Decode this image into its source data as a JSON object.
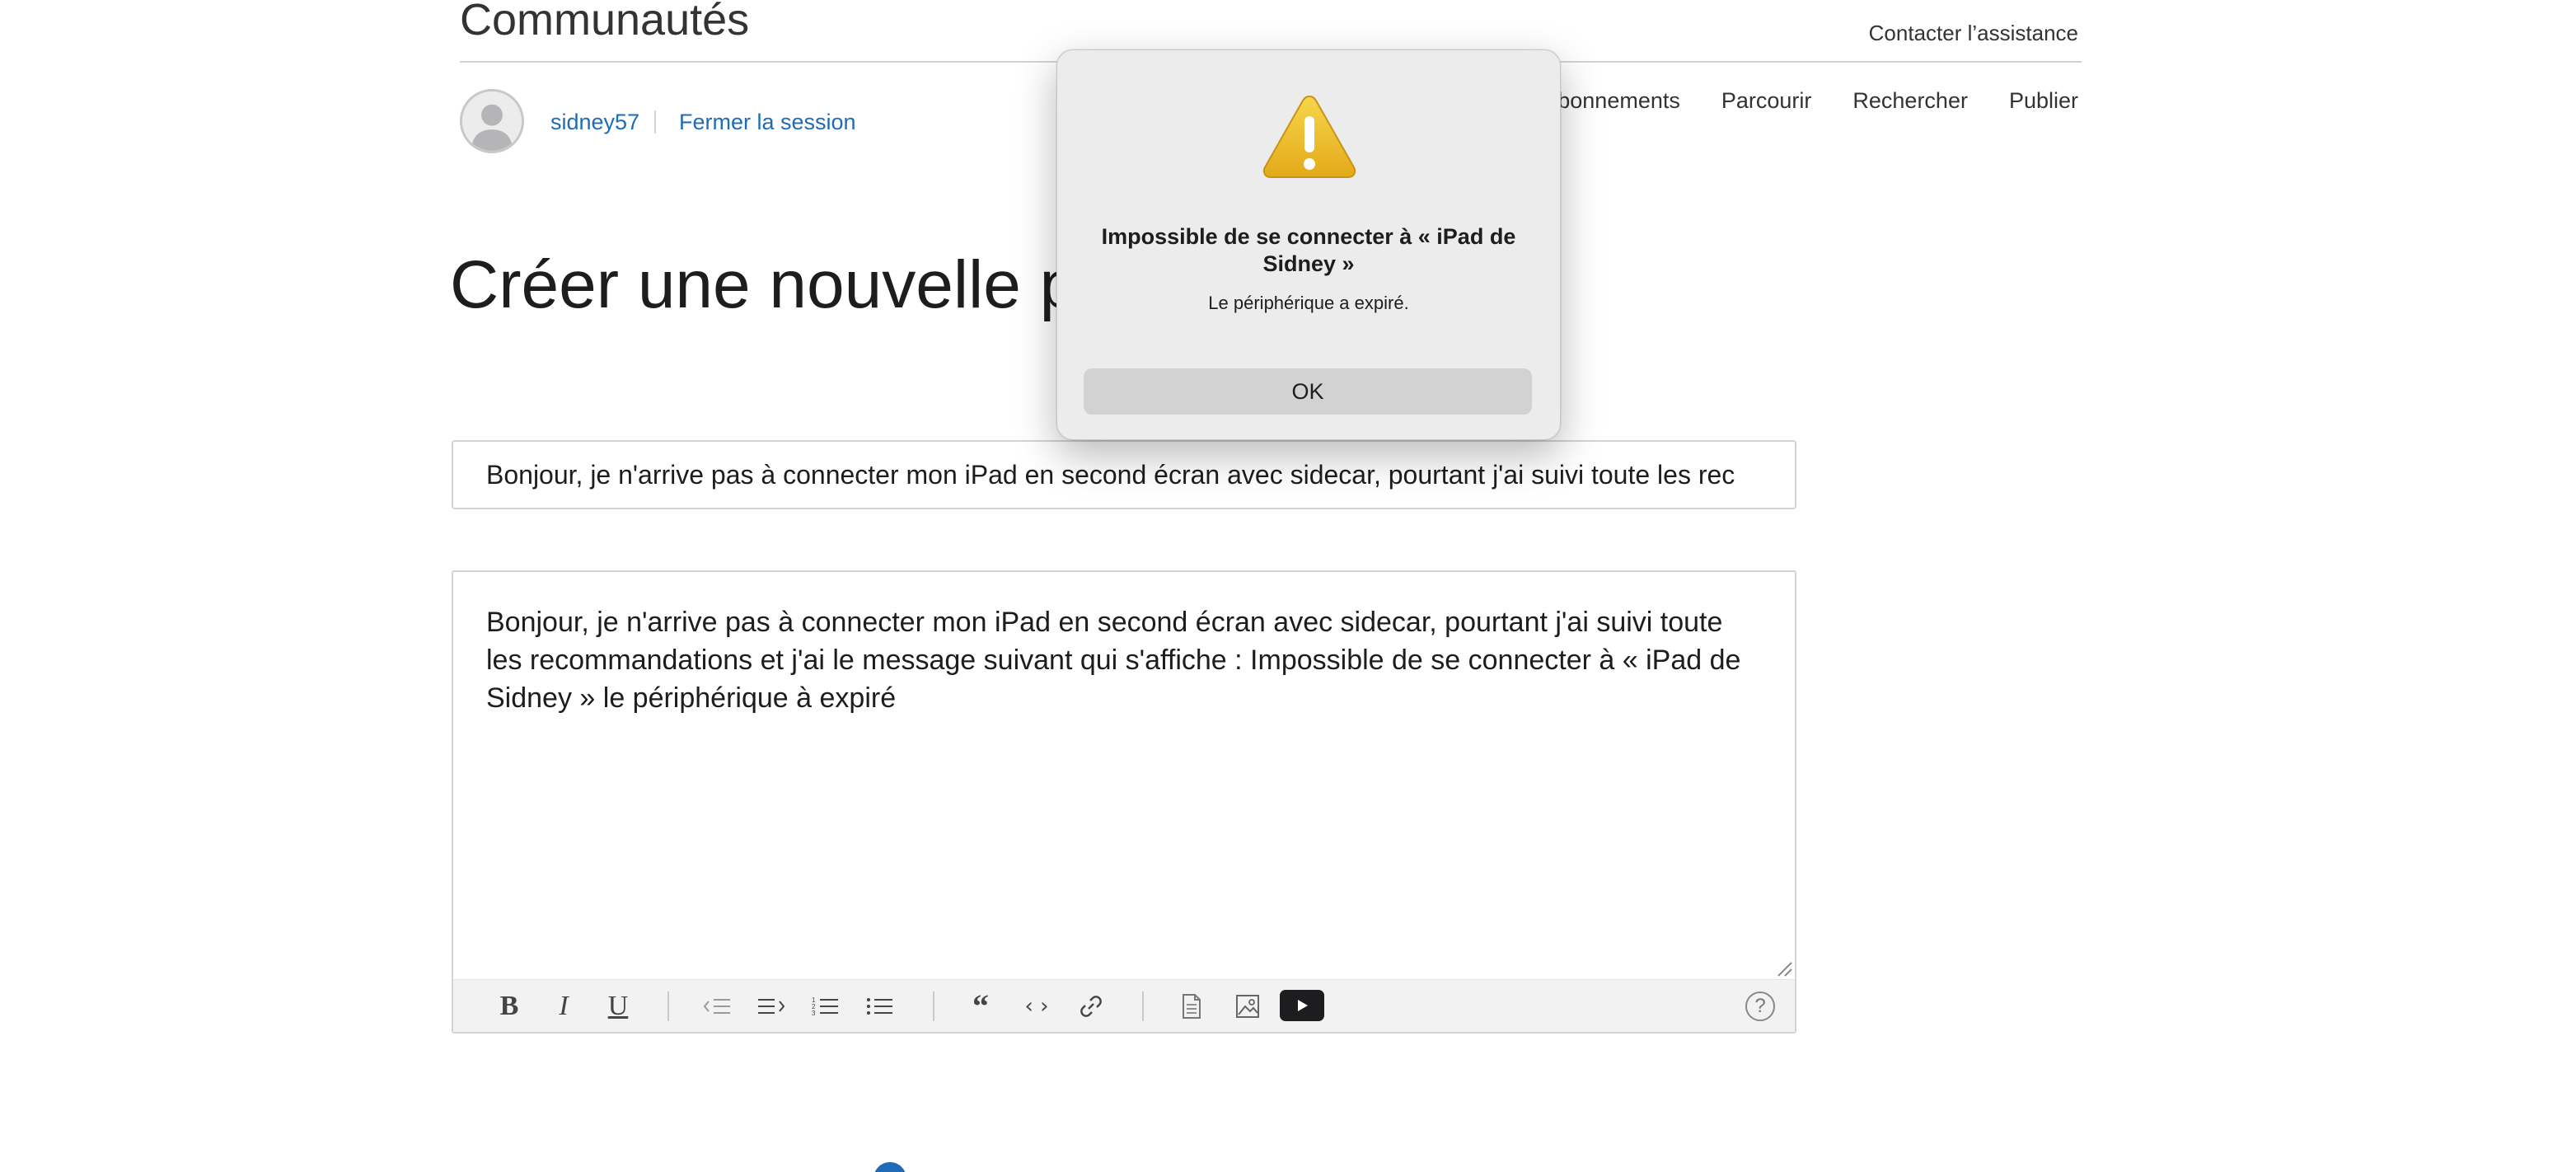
{
  "header": {
    "title": "Communautés",
    "support_link": "Contacter l’assistance"
  },
  "user": {
    "username": "sidney57",
    "logout": "Fermer la session"
  },
  "nav": {
    "items": [
      "s abonnements",
      "Parcourir",
      "Rechercher",
      "Publier"
    ]
  },
  "page": {
    "title": "Créer une nouvelle pub"
  },
  "form": {
    "subject_value": "Bonjour, je n'arrive pas à connecter mon iPad en second écran avec sidecar, pourtant j'ai suivi toute les rec",
    "body_text": "Bonjour, je n'arrive pas à connecter mon iPad en second écran avec sidecar, pourtant j'ai suivi toute les recommandations et j'ai le message suivant qui s'affiche : Impossible de se connecter à « iPad de Sidney » le périphérique à expiré"
  },
  "toolbar": {
    "bold": "B",
    "italic": "I",
    "underline": "U",
    "quote": "“",
    "code": "‹ ›",
    "help": "?"
  },
  "dialog": {
    "title": "Impossible de se connecter à « iPad de Sidney »",
    "message": "Le périphérique a expiré.",
    "ok_label": "OK"
  },
  "colors": {
    "link": "#1e6bb8",
    "dialog_bg": "#ececec",
    "warning_yellow": "#f2c230"
  }
}
